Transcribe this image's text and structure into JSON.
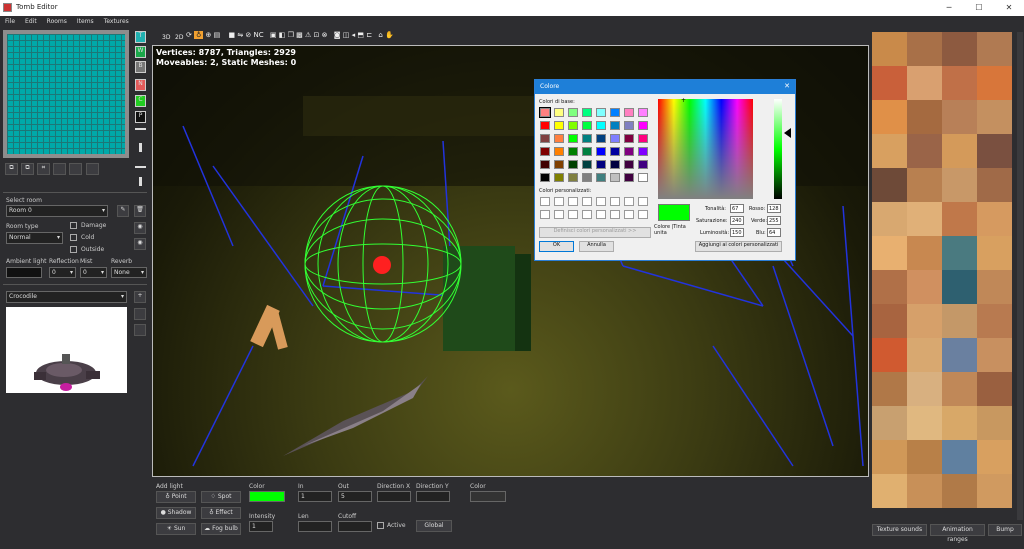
{
  "app": {
    "title": "Tomb Editor"
  },
  "menu": [
    "File",
    "Edit",
    "Rooms",
    "Items",
    "Textures"
  ],
  "side_buttons": [
    "T",
    "W",
    "B",
    "N",
    "C",
    "P"
  ],
  "toolbar": {
    "btn_3d": "3D",
    "btn_2d": "2D"
  },
  "viewport": {
    "stats1": "Vertices: 8787, Triangles: 2929",
    "stats2": "Moveables: 2, Static Meshes: 0"
  },
  "room": {
    "select_label": "Select room",
    "selected": "Room 0",
    "type_label": "Room type",
    "type_value": "Normal",
    "damage": "Damage",
    "cold": "Cold",
    "outside": "Outside",
    "ambient_label": "Ambient light",
    "reflection_label": "Reflection",
    "reflection_value": "0",
    "mist_label": "Mist",
    "mist_value": "0",
    "reverb_label": "Reverb",
    "reverb_value": "None"
  },
  "object": {
    "selected": "Crocodile"
  },
  "lights": {
    "add_light": "Add light",
    "point": "Point",
    "spot": "Spot",
    "shadow": "Shadow",
    "effect": "Effect",
    "sun": "Sun",
    "fog": "Fog bulb",
    "color_label": "Color",
    "color_value": "#00ff00",
    "intensity_label": "Intensity",
    "intensity_value": "1",
    "in_label": "In",
    "in_value": "1",
    "out_label": "Out",
    "out_value": "5",
    "len_label": "Len",
    "cutoff_label": "Cutoff",
    "active_label": "Active",
    "dirx_label": "Direction X",
    "diry_label": "Direction Y",
    "global_label": "Global",
    "color2_label": "Color"
  },
  "texture_tabs": [
    "Texture sounds",
    "Animation ranges",
    "Bump"
  ],
  "dialog": {
    "title": "Colore",
    "basic": "Colori di base:",
    "custom": "Colori personalizzati:",
    "define": "Definisci colori personalizzati >>",
    "ok": "OK",
    "cancel": "Annulla",
    "preview_label": "Colore |Tinta unita",
    "hue_label": "Tonalità:",
    "hue": "67",
    "sat_label": "Saturazione:",
    "sat": "240",
    "lum_label": "Luminosità:",
    "lum": "150",
    "red_label": "Rosso:",
    "red": "128",
    "green_label": "Verde:",
    "green": "255",
    "blue_label": "Blu:",
    "blue": "64",
    "add_custom": "Aggiungi ai colori personalizzati",
    "basic_colors": [
      "#ff8080",
      "#ffff80",
      "#80ff80",
      "#00ff80",
      "#80ffff",
      "#0080ff",
      "#ff80c0",
      "#ff80ff",
      "#ff0000",
      "#ffff00",
      "#80ff00",
      "#00ff40",
      "#00ffff",
      "#0080c0",
      "#8080c0",
      "#ff00ff",
      "#804040",
      "#ff8040",
      "#00ff00",
      "#008080",
      "#004080",
      "#8080ff",
      "#800040",
      "#ff0080",
      "#800000",
      "#ff8000",
      "#008000",
      "#008040",
      "#0000ff",
      "#0000a0",
      "#800080",
      "#8000ff",
      "#400000",
      "#804000",
      "#004000",
      "#004040",
      "#000080",
      "#000040",
      "#400040",
      "#400080",
      "#000000",
      "#808000",
      "#808040",
      "#808080",
      "#408080",
      "#c0c0c0",
      "#400040",
      "#ffffff"
    ]
  }
}
